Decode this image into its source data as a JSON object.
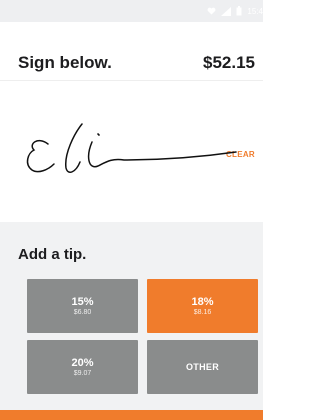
{
  "status": {
    "time": "15:4",
    "icons": [
      "heart-icon",
      "signal-icon",
      "battery-icon"
    ]
  },
  "header": {
    "title": "Sign below.",
    "amount": "$52.15"
  },
  "signature": {
    "clear_label": "CLEAR"
  },
  "tip": {
    "title": "Add a tip.",
    "options": [
      {
        "percent": "15%",
        "amount": "$6.80",
        "selected": false
      },
      {
        "percent": "18%",
        "amount": "$8.16",
        "selected": true
      },
      {
        "percent": "20%",
        "amount": "$9.07",
        "selected": false
      },
      {
        "label": "OTHER",
        "selected": false
      }
    ]
  },
  "colors": {
    "accent": "#f07c2c",
    "tip_button": "#8a8c8c",
    "panel_bg": "#f1f2f3",
    "text": "#1d1d1f"
  }
}
